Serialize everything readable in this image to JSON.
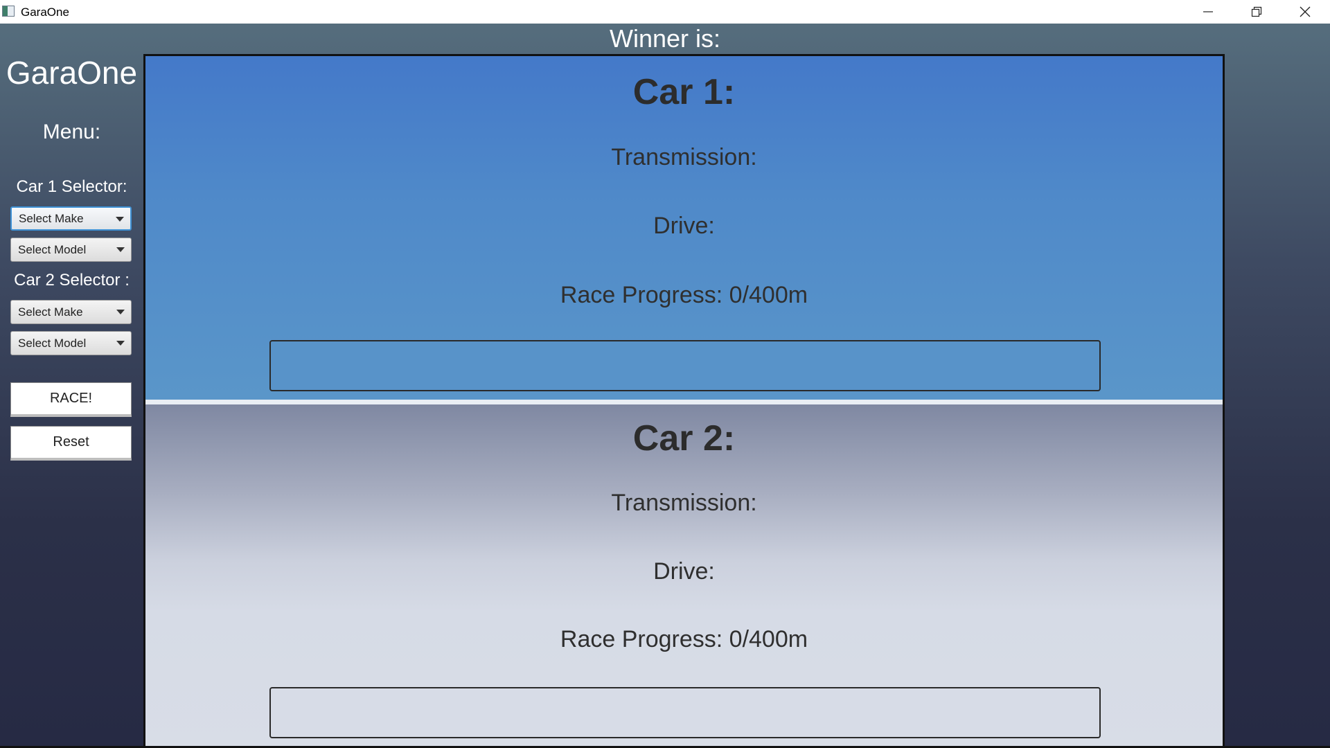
{
  "window": {
    "title": "GaraOne",
    "controls": [
      "minimize-icon",
      "restore-icon",
      "close-icon"
    ]
  },
  "header": {
    "winner_label": "Winner is:"
  },
  "sidebar": {
    "app_title": "GaraOne",
    "menu_label": "Menu:",
    "car1_selector_label": "Car 1 Selector:",
    "car2_selector_label": "Car 2 Selector :",
    "car1_make": {
      "value": "Select Make",
      "icon": "chevron-down-icon"
    },
    "car1_model": {
      "value": "Select Model",
      "icon": "chevron-down-icon"
    },
    "car2_make": {
      "value": "Select Make",
      "icon": "chevron-down-icon"
    },
    "car2_model": {
      "value": "Select Model",
      "icon": "chevron-down-icon"
    },
    "race_button": "RACE!",
    "reset_button": "Reset"
  },
  "cars": [
    {
      "title": "Car 1:",
      "transmission": "Transmission:",
      "drive": "Drive:",
      "progress_text": "Race Progress: 0/400m",
      "progress_fraction": 0
    },
    {
      "title": "Car 2:",
      "transmission": "Transmission:",
      "drive": "Drive:",
      "progress_text": "Race Progress: 0/400m",
      "progress_fraction": 0
    }
  ],
  "colors": {
    "car1_panel": "#4f89c9",
    "car2_panel": "#d6dbe6",
    "combo_focus": "#3f92d6"
  }
}
